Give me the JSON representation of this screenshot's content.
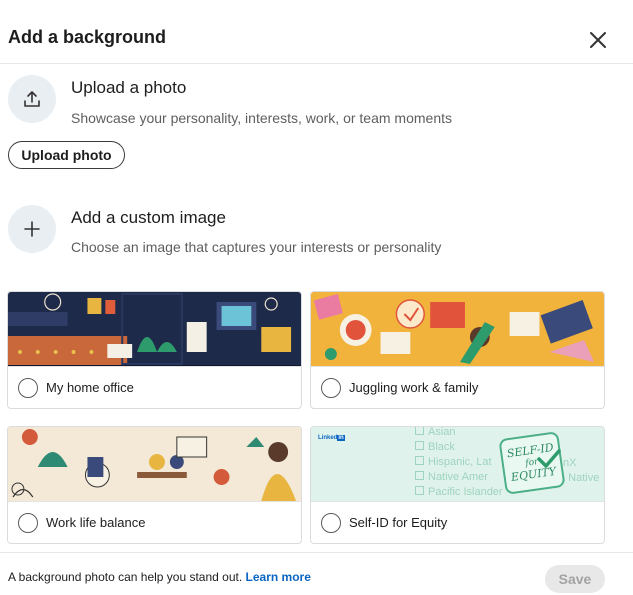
{
  "header": {
    "title": "Add a background"
  },
  "upload": {
    "title": "Upload a photo",
    "description": "Showcase your personality, interests, work, or team moments",
    "button_label": "Upload photo"
  },
  "custom": {
    "title": "Add a custom image",
    "description": "Choose an image that captures your interests or personality"
  },
  "options": [
    {
      "label": "My home office"
    },
    {
      "label": "Juggling work & family"
    },
    {
      "label": "Work life balance"
    },
    {
      "label": "Self-ID for Equity"
    }
  ],
  "equity_art": {
    "brand": "Linked",
    "brand_in": "in",
    "stamp_line1": "SELF-ID",
    "stamp_line2": "for",
    "stamp_line3": "EQUITY",
    "list": [
      "Asian",
      "Black",
      "Hispanic, Lat",
      "Native Amer",
      "Pacific Islander"
    ],
    "right_fragments": [
      "nX",
      "a Native"
    ]
  },
  "footer": {
    "hint": "A background photo can help you stand out.",
    "learn_more": "Learn more",
    "save_label": "Save"
  },
  "colors": {
    "link": "#0a66c2",
    "icon_circle": "#e9eef3",
    "save_disabled_bg": "#e8e8e8"
  }
}
